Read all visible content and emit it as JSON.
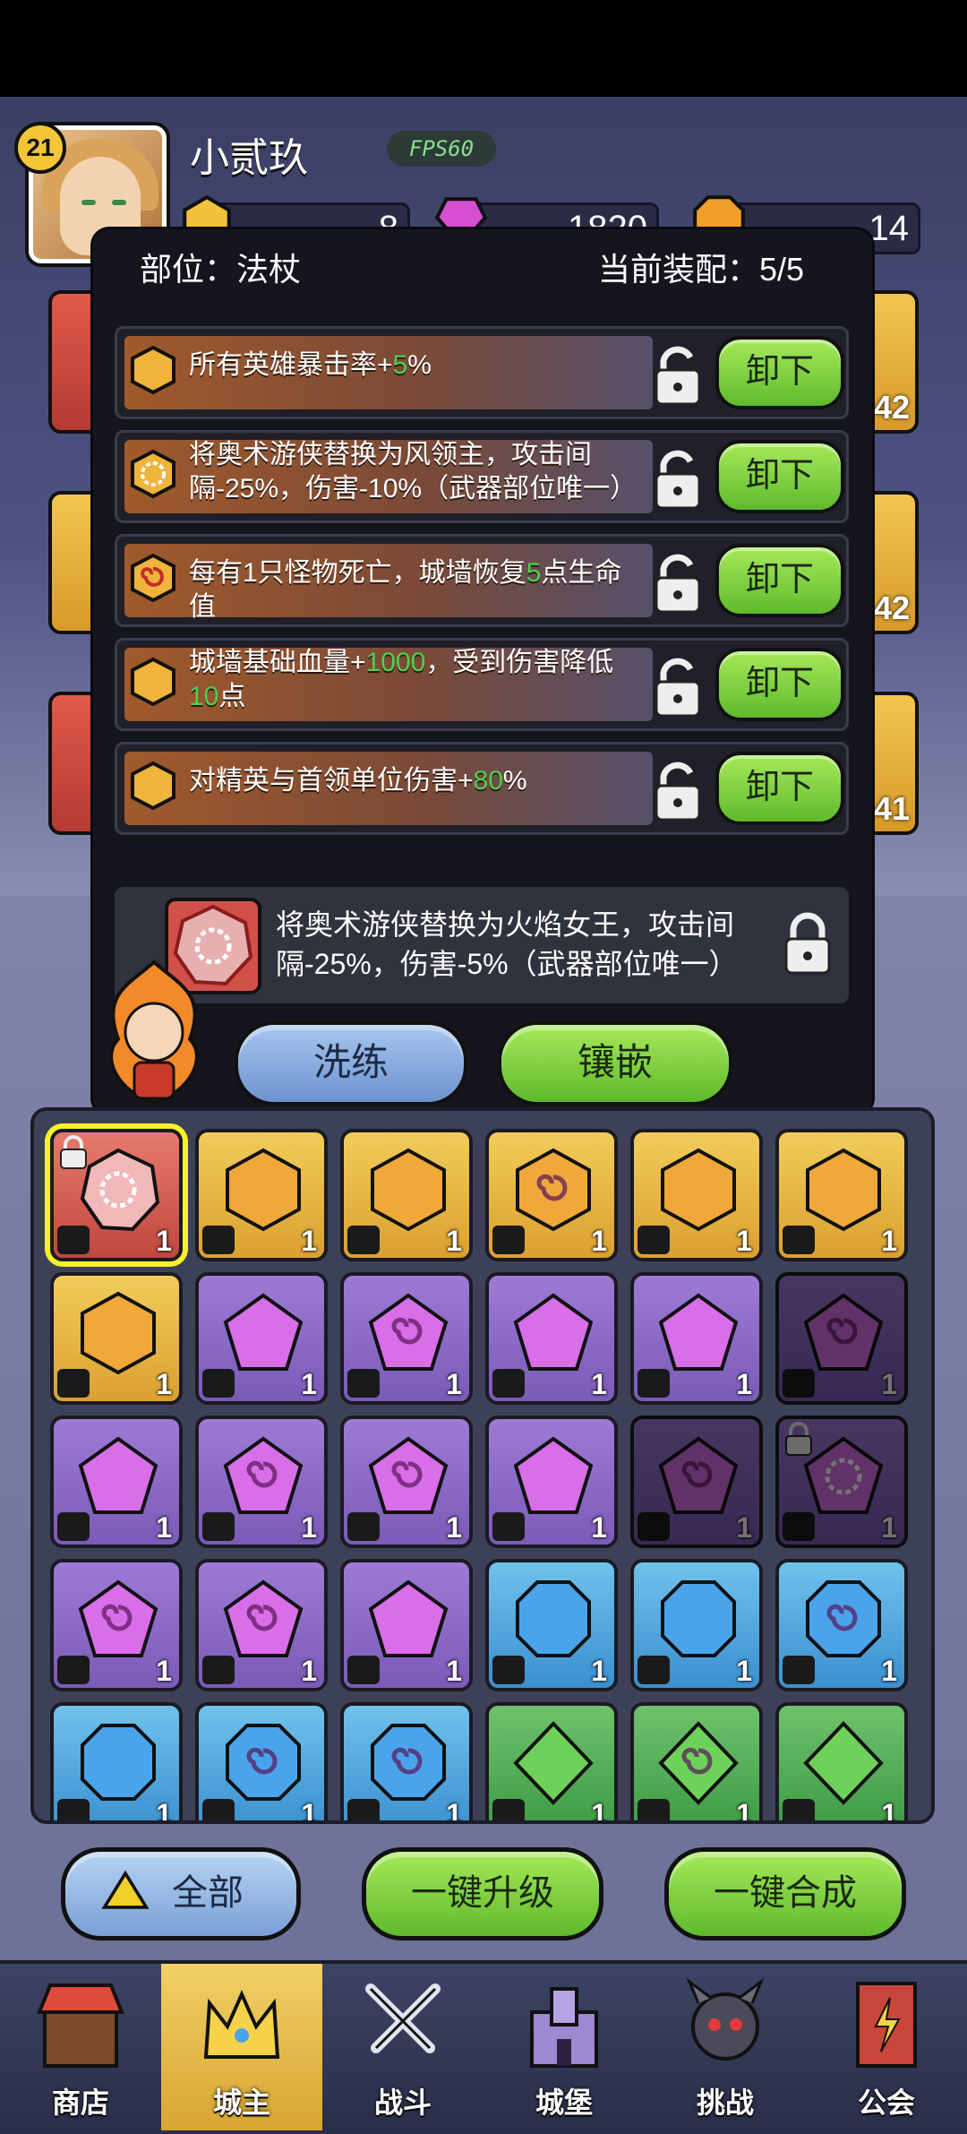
{
  "player": {
    "level": "21",
    "name": "小贰玖",
    "fps": "FPS60"
  },
  "resources": [
    {
      "icon": "gold-gem-icon",
      "value": "8",
      "color": "#f2c23a"
    },
    {
      "icon": "pink-crystal-icon",
      "value": "1820",
      "color": "#d64fd0"
    },
    {
      "icon": "orange-gem-icon",
      "value": "14",
      "color": "#f0a028"
    }
  ],
  "side_levels": [
    "42",
    "42",
    "41"
  ],
  "popup": {
    "slot_label": "部位：法杖",
    "equip_count": "当前装配：5/5",
    "unload_label": "卸下",
    "affixes": [
      {
        "pre": "所有英雄暴击率+",
        "hl": "5",
        "post": "%",
        "pre2": "",
        "hl2": "",
        "post2": "",
        "gem": "plain"
      },
      {
        "pre": "将奥术游侠替换为风领主，攻击间隔-25%，伤害-10%（武器部位唯一）",
        "hl": "",
        "post": "",
        "pre2": "",
        "hl2": "",
        "post2": "",
        "gem": "rune"
      },
      {
        "pre": "每有1只怪物死亡，城墙恢复",
        "hl": "5",
        "post": "点生命值",
        "pre2": "",
        "hl2": "",
        "post2": "",
        "gem": "swirl"
      },
      {
        "pre": "城墙基础血量+",
        "hl": "1000",
        "post": "，受到伤害降低",
        "pre2": "",
        "hl2": "10",
        "post2": "点",
        "gem": "plain"
      },
      {
        "pre": "对精英与首领单位伤害+",
        "hl": "80",
        "post": "%",
        "pre2": "",
        "hl2": "",
        "post2": "",
        "gem": "plain"
      }
    ],
    "preview_text": "将奥术游侠替换为火焰女王，攻击间隔-25%，伤害-5%（武器部位唯一）",
    "reroll_label": "洗练",
    "inlay_label": "镶嵌"
  },
  "inventory": [
    {
      "color": "red",
      "gem": "rune",
      "count": "1",
      "selected": true,
      "locked": true,
      "dim": false
    },
    {
      "color": "gold",
      "gem": "hex",
      "count": "1"
    },
    {
      "color": "gold",
      "gem": "hex",
      "count": "1"
    },
    {
      "color": "gold",
      "gem": "hex-swirl",
      "count": "1"
    },
    {
      "color": "gold",
      "gem": "hex",
      "count": "1"
    },
    {
      "color": "gold",
      "gem": "hex",
      "count": "1"
    },
    {
      "color": "gold",
      "gem": "hex",
      "count": "1"
    },
    {
      "color": "purple",
      "gem": "pent",
      "count": "1"
    },
    {
      "color": "purple",
      "gem": "pent-swirl",
      "count": "1"
    },
    {
      "color": "purple",
      "gem": "pent",
      "count": "1"
    },
    {
      "color": "purple",
      "gem": "pent",
      "count": "1"
    },
    {
      "color": "purple",
      "gem": "pent-swirl",
      "count": "1",
      "dim": true
    },
    {
      "color": "purple",
      "gem": "pent",
      "count": "1"
    },
    {
      "color": "purple",
      "gem": "pent-swirl",
      "count": "1"
    },
    {
      "color": "purple",
      "gem": "pent-swirl",
      "count": "1"
    },
    {
      "color": "purple",
      "gem": "pent",
      "count": "1"
    },
    {
      "color": "purple",
      "gem": "pent-swirl",
      "count": "1",
      "dim": true
    },
    {
      "color": "purple",
      "gem": "pent-rune",
      "count": "1",
      "dim": true,
      "locked": true
    },
    {
      "color": "purple",
      "gem": "pent-swirl",
      "count": "1"
    },
    {
      "color": "purple",
      "gem": "pent-swirl",
      "count": "1"
    },
    {
      "color": "purple",
      "gem": "pent",
      "count": "1"
    },
    {
      "color": "blue",
      "gem": "oct",
      "count": "1"
    },
    {
      "color": "blue",
      "gem": "oct",
      "count": "1"
    },
    {
      "color": "blue",
      "gem": "oct-swirl",
      "count": "1"
    },
    {
      "color": "blue",
      "gem": "oct",
      "count": "1"
    },
    {
      "color": "blue",
      "gem": "oct-swirl",
      "count": "1"
    },
    {
      "color": "blue",
      "gem": "oct-swirl",
      "count": "1"
    },
    {
      "color": "green",
      "gem": "dia",
      "count": "1"
    },
    {
      "color": "green",
      "gem": "dia-swirl",
      "count": "1"
    },
    {
      "color": "green",
      "gem": "dia",
      "count": "1"
    }
  ],
  "actions": {
    "filter_label": "全部",
    "upgrade_all_label": "一键升级",
    "merge_all_label": "一键合成"
  },
  "nav": [
    {
      "label": "商店",
      "icon": "shop-icon"
    },
    {
      "label": "城主",
      "icon": "crown-icon"
    },
    {
      "label": "战斗",
      "icon": "swords-icon"
    },
    {
      "label": "城堡",
      "icon": "castle-icon"
    },
    {
      "label": "挑战",
      "icon": "demon-icon"
    },
    {
      "label": "公会",
      "icon": "guild-banner-icon"
    }
  ]
}
